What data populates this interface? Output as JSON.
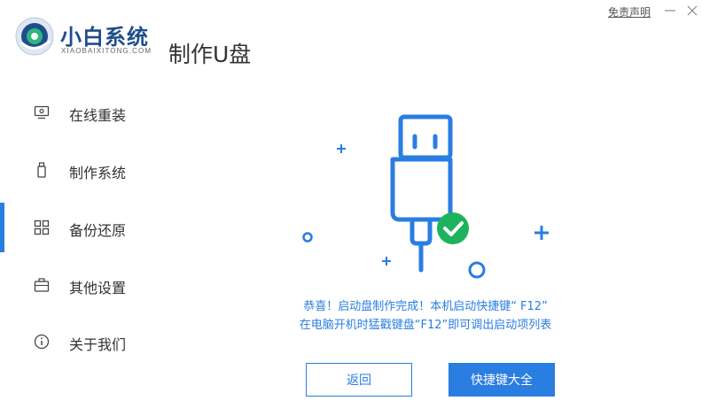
{
  "header": {
    "disclaimer_link": "免责声明",
    "brand_cn": "小白系统",
    "brand_en": "XIAOBAIXITONG.COM",
    "page_title": "制作U盘"
  },
  "sidebar": {
    "items": [
      {
        "label": "在线重装",
        "icon": "monitor-icon"
      },
      {
        "label": "制作系统",
        "icon": "usb-drive-icon"
      },
      {
        "label": "备份还原",
        "icon": "grid-icon"
      },
      {
        "label": "其他设置",
        "icon": "briefcase-icon"
      },
      {
        "label": "关于我们",
        "icon": "info-icon"
      }
    ],
    "active_index": 2
  },
  "main": {
    "message_line1": "恭喜！启动盘制作完成！本机启动快捷键“ F12”",
    "message_line2": "在电脑开机时猛戳键盘“F12”即可调出启动项列表",
    "back_button": "返回",
    "hotkeys_button": "快捷键大全"
  },
  "colors": {
    "accent": "#2a7de1",
    "brand": "#1f4e8c",
    "success": "#1db35c"
  }
}
